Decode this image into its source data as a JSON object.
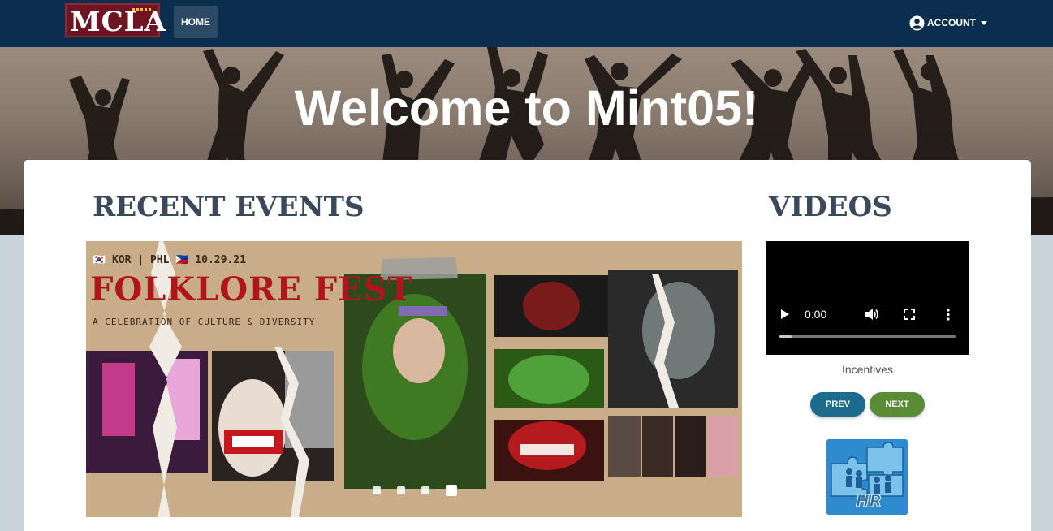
{
  "navbar": {
    "logo_text": "MCLA",
    "home_label": "HOME",
    "account_label": "ACCOUNT"
  },
  "hero": {
    "title": "Welcome to Mint05!"
  },
  "main": {
    "events_title": "RECENT EVENTS",
    "videos_title": "VIDEOS"
  },
  "carousel": {
    "poster_tag": "🇰🇷 KOR | PHL 🇵🇭  10.29.21",
    "poster_title": "FOLKLORE FEST",
    "poster_subtitle": "A CELEBRATION OF CULTURE & DIVERSITY",
    "slide_count": 4,
    "active_slide": 4
  },
  "video": {
    "time": "0:00",
    "caption": "Incentives",
    "prev_label": "PREV",
    "next_label": "NEXT"
  },
  "hr_logo": {
    "text": "HR"
  },
  "colors": {
    "navbar": "#0b2e4f",
    "heading": "#3a4a5c",
    "prev_button": "#1c6a8c",
    "next_button": "#5a8c35",
    "poster_title": "#b0151b"
  }
}
